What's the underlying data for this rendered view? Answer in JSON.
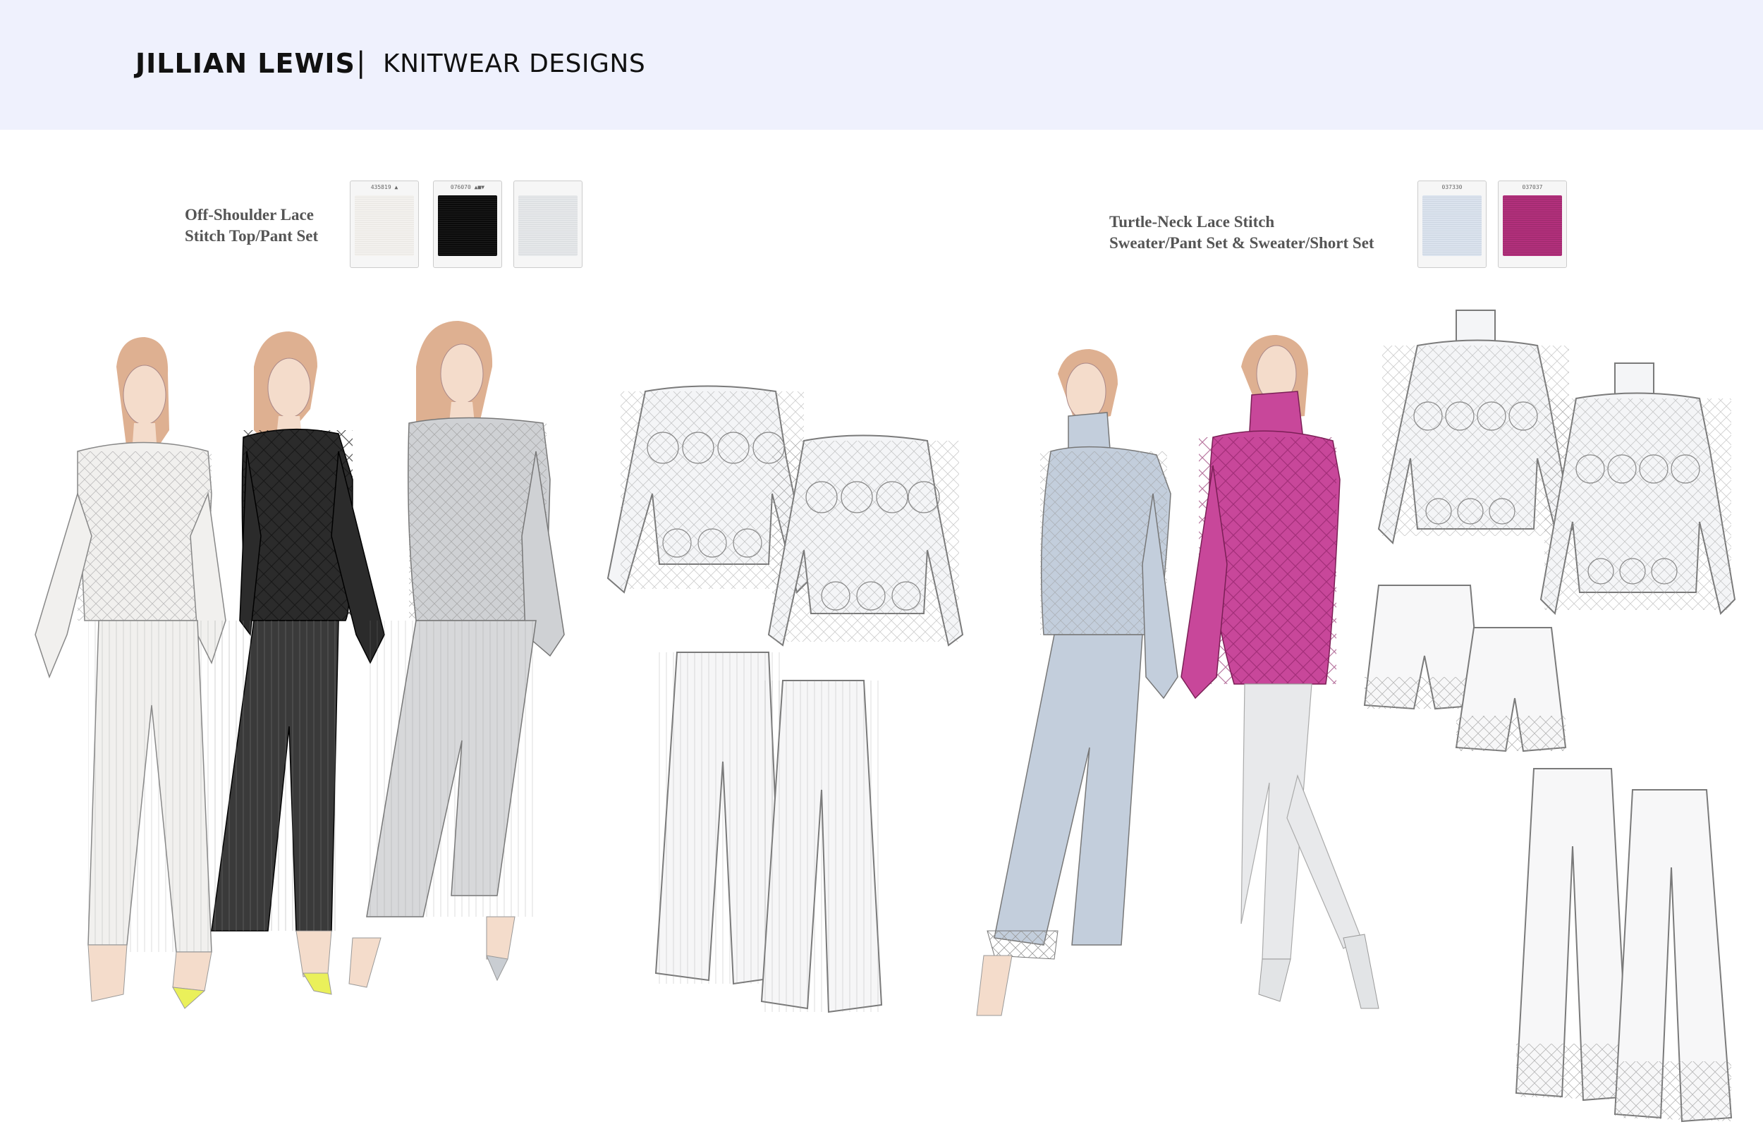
{
  "header": {
    "brand": "JILLIAN LEWIS",
    "separator": "|",
    "subtitle": "KNITWEAR DESIGNS"
  },
  "collections": [
    {
      "caption_line1": "Off-Shoulder Lace",
      "caption_line2": "Stitch Top/Pant Set",
      "swatches": [
        {
          "label": "435819 ▲",
          "color": "#f1efec"
        },
        {
          "label": "076070 ▲■▼",
          "color": "#0b0b0b"
        },
        {
          "label": "",
          "color": "#e4e6e8"
        }
      ]
    },
    {
      "caption_line1": "Turtle-Neck Lace Stitch",
      "caption_line2": "Sweater/Pant Set & Sweater/Short Set",
      "swatches": [
        {
          "label": "037330",
          "color": "#d9e1ec"
        },
        {
          "label": "037037",
          "color": "#b2307c"
        }
      ]
    }
  ],
  "colors": {
    "header_bg": "#eff1fd",
    "white_knit": "#f3f2f0",
    "black_knit": "#2b2b2b",
    "grey_knit": "#cfd1d4",
    "blue_knit": "#c3cedc",
    "pink_knit": "#c8479a",
    "hair": "#d8a27e",
    "skin": "#f2d6c2"
  }
}
